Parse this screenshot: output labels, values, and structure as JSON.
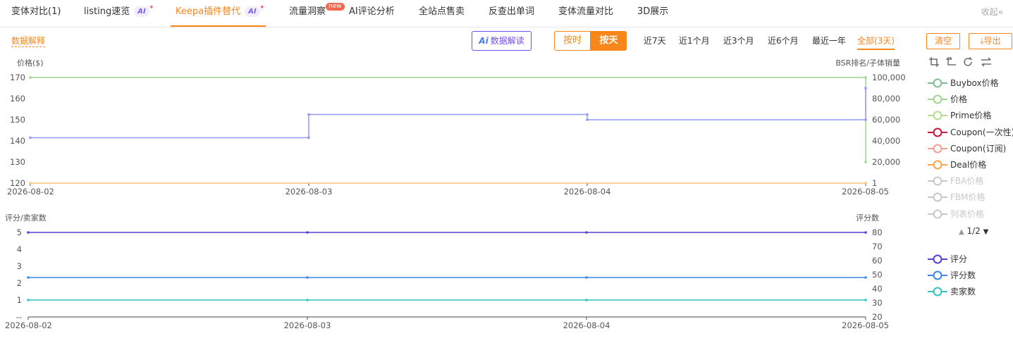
{
  "tabs": [
    {
      "label": "变体对比(1)",
      "active": false
    },
    {
      "label": "listing速览",
      "active": false,
      "ai": "AI"
    },
    {
      "label": "Keepa插件替代",
      "active": true,
      "ai": "AI"
    },
    {
      "label": "流量洞察",
      "active": false,
      "badge": "new"
    },
    {
      "label": "AI评论分析",
      "active": false
    },
    {
      "label": "全站点售卖",
      "active": false
    },
    {
      "label": "反查出单词",
      "active": false
    },
    {
      "label": "变体流量对比",
      "active": false
    },
    {
      "label": "3D展示",
      "active": false
    }
  ],
  "collapse_label": "收起",
  "toolbar": {
    "data_explain": "数据解释",
    "ai_logo": "Ai",
    "ai_button": "数据解读",
    "by_hour": "按时",
    "by_day": "按天",
    "ranges": [
      "近7天",
      "近1个月",
      "近3个月",
      "近6个月",
      "最近一年",
      "全部(3天)"
    ],
    "active_range": "全部(3天)",
    "clear": "清空",
    "export": "导出"
  },
  "tool_icons": [
    "crop-icon",
    "crop-alt-icon",
    "refresh-icon",
    "swap-icon"
  ],
  "pager": {
    "text": "1/2"
  },
  "legend_top": [
    {
      "label": "Buybox价格",
      "color": "#7dbf8d",
      "enabled": true
    },
    {
      "label": "价格",
      "color": "#9fd48d",
      "enabled": true
    },
    {
      "label": "Prime价格",
      "color": "#b5de8f",
      "enabled": true
    },
    {
      "label": "Coupon(一次性)",
      "color": "#c9173c",
      "enabled": true
    },
    {
      "label": "Coupon(订阅)",
      "color": "#f0a08f",
      "enabled": true
    },
    {
      "label": "Deal价格",
      "color": "#f7a54a",
      "enabled": true
    },
    {
      "label": "FBA价格",
      "color": "#c8c8c8",
      "enabled": false
    },
    {
      "label": "FBM价格",
      "color": "#c8c8c8",
      "enabled": false
    },
    {
      "label": "列表价格",
      "color": "#c8c8c8",
      "enabled": false
    }
  ],
  "legend_bottom": [
    {
      "label": "评分",
      "color": "#5a3fd0",
      "enabled": true
    },
    {
      "label": "评分数",
      "color": "#3f86e8",
      "enabled": true
    },
    {
      "label": "卖家数",
      "color": "#32c4c0",
      "enabled": true
    }
  ],
  "chart_data": [
    {
      "type": "line",
      "ylabel_left": "价格($)",
      "ylabel_right": "BSR排名/子体销量",
      "x": [
        "2026-08-02",
        "2026-08-03",
        "2026-08-04",
        "2026-08-05"
      ],
      "yticks_left": [
        "170",
        "160",
        "150",
        "140",
        "130",
        "120"
      ],
      "yticks_right": [
        "100,000",
        "80,000",
        "60,000",
        "40,000",
        "20,000",
        "1"
      ],
      "ylim_left": [
        120,
        170
      ],
      "ylim_right": [
        1,
        100000
      ],
      "series": [
        {
          "name": "价格",
          "color": "#9fd48d",
          "axis": "left",
          "step": true,
          "points": [
            [
              "2026-08-02",
              170
            ],
            [
              "2026-08-05",
              170
            ],
            [
              "2026-08-05",
              130
            ]
          ]
        },
        {
          "axis": "right",
          "color": "#8f98f5",
          "step": true,
          "points": [
            [
              "2026-08-02",
              43000
            ],
            [
              "2026-08-03",
              43000
            ],
            [
              "2026-08-03",
              65000
            ],
            [
              "2026-08-04",
              65000
            ],
            [
              "2026-08-04",
              60000
            ],
            [
              "2026-08-05",
              60000
            ],
            [
              "2026-08-05",
              90000
            ]
          ]
        },
        {
          "name": "Deal价格",
          "color": "#f7c27a",
          "axis": "left",
          "step": true,
          "points": [
            [
              "2026-08-02",
              120
            ],
            [
              "2026-08-05",
              120
            ]
          ]
        }
      ]
    },
    {
      "type": "line",
      "ylabel_left": "评分/卖家数",
      "ylabel_right": "评分数",
      "x": [
        "2026-08-02",
        "2026-08-03",
        "2026-08-04",
        "2026-08-05"
      ],
      "yticks_left": [
        "5",
        "4",
        "3",
        "2",
        "1",
        "--"
      ],
      "yticks_right": [
        "80",
        "70",
        "60",
        "50",
        "40",
        "30",
        "20"
      ],
      "ylim_left": [
        0,
        5
      ],
      "ylim_right": [
        20,
        80
      ],
      "series": [
        {
          "name": "评分",
          "color": "#5a3fd0",
          "axis": "left",
          "values": [
            5,
            5,
            5,
            5
          ]
        },
        {
          "name": "评分数",
          "color": "#3f86e8",
          "axis": "right",
          "values": [
            48,
            48,
            48,
            48
          ]
        },
        {
          "name": "卖家数",
          "color": "#32c4c0",
          "axis": "left",
          "values": [
            1,
            1,
            1,
            1
          ]
        }
      ]
    }
  ]
}
